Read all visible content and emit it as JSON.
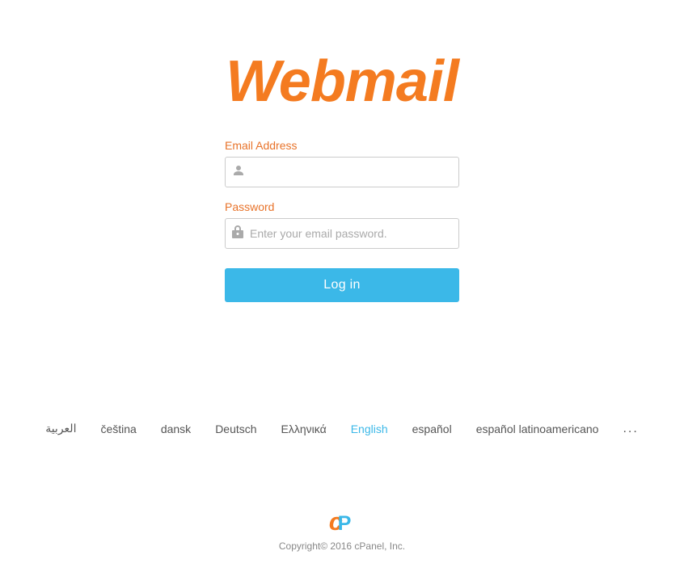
{
  "logo": {
    "text": "Webmail"
  },
  "form": {
    "email_label": "Email Address",
    "email_placeholder": "",
    "password_label": "Password",
    "password_placeholder": "Enter your email password.",
    "login_button": "Log in"
  },
  "languages": {
    "items": [
      {
        "label": "العربية",
        "active": false
      },
      {
        "label": "čeština",
        "active": false
      },
      {
        "label": "dansk",
        "active": false
      },
      {
        "label": "Deutsch",
        "active": false
      },
      {
        "label": "Ελληνικά",
        "active": false
      },
      {
        "label": "English",
        "active": true
      },
      {
        "label": "español",
        "active": false
      },
      {
        "label": "español latinoamericano",
        "active": false
      }
    ],
    "more": "..."
  },
  "footer": {
    "copyright": "Copyright© 2016 cPanel, Inc."
  },
  "colors": {
    "brand_orange": "#f47b20",
    "brand_blue": "#3bb8e8",
    "text_gray": "#555555",
    "label_orange": "#e8732a"
  }
}
